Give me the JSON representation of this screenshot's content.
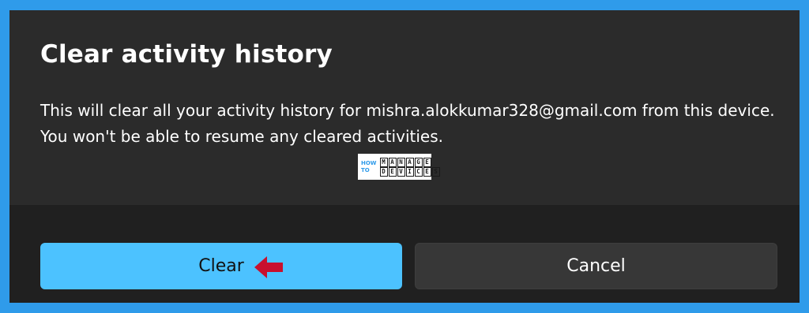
{
  "dialog": {
    "title": "Clear activity history",
    "message": "This will clear all your activity history for mishra.alokkumar328@gmail.com from this device. You won't be able to resume any cleared activities."
  },
  "watermark": {
    "how": "HOW",
    "to": "TO",
    "manage": "MANAGE",
    "devices": "DEVICES"
  },
  "buttons": {
    "clear_label": "Clear",
    "cancel_label": "Cancel"
  },
  "colors": {
    "background": "#2f9bea",
    "dialog": "#2b2b2b",
    "footer": "#202020",
    "accent_button": "#4cc2ff",
    "secondary_button": "#373737",
    "arrow": "#c8102e"
  },
  "icons": {
    "annotation": "red-arrow-icon"
  }
}
